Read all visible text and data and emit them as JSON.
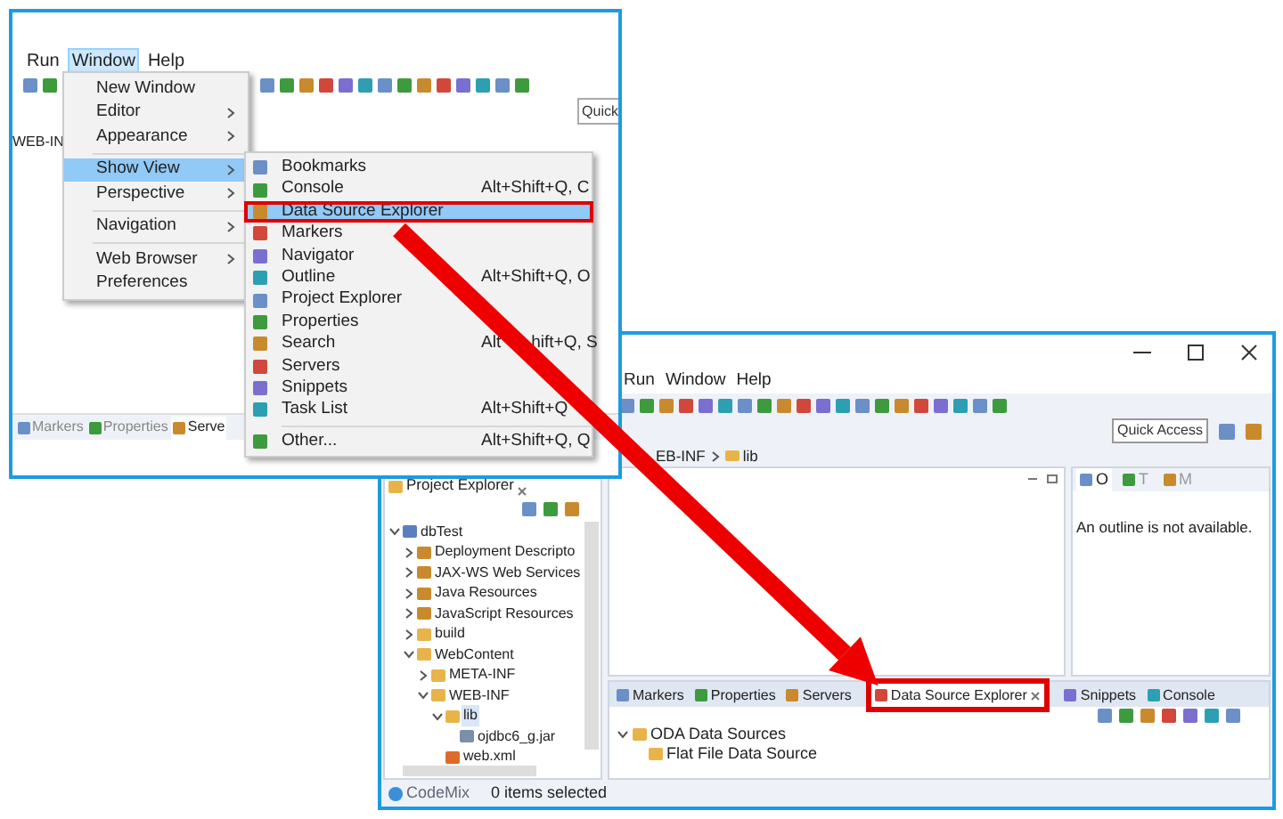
{
  "left_window": {
    "menu_bar": [
      {
        "label": "Run",
        "selected": false
      },
      {
        "label": "Window",
        "selected": true
      },
      {
        "label": "Help",
        "selected": false
      }
    ],
    "quick_access": {
      "placeholder": "Quick"
    },
    "breadcrumb": "WEB-IN",
    "bottom_tabs": [
      {
        "label": "Markers",
        "selected": false
      },
      {
        "label": "Properties",
        "selected": false
      },
      {
        "label": "Serve",
        "selected": true
      }
    ],
    "window_menu": [
      {
        "kind": "item",
        "label": "New Window",
        "submenu": false,
        "selected": false
      },
      {
        "kind": "item",
        "label": "Editor",
        "submenu": true,
        "selected": false
      },
      {
        "kind": "item",
        "label": "Appearance",
        "submenu": true,
        "selected": false
      },
      {
        "kind": "separator"
      },
      {
        "kind": "item",
        "label": "Show View",
        "submenu": true,
        "selected": true
      },
      {
        "kind": "item",
        "label": "Perspective",
        "submenu": true,
        "selected": false
      },
      {
        "kind": "separator"
      },
      {
        "kind": "item",
        "label": "Navigation",
        "submenu": true,
        "selected": false
      },
      {
        "kind": "separator"
      },
      {
        "kind": "item",
        "label": "Web Browser",
        "submenu": true,
        "selected": false
      },
      {
        "kind": "item",
        "label": "Preferences",
        "submenu": false,
        "selected": false
      }
    ],
    "show_view_menu": [
      {
        "kind": "item",
        "label": "Bookmarks",
        "selected": false
      },
      {
        "kind": "item",
        "label": "Console",
        "shortcut": "Alt+Shift+Q, C",
        "selected": false
      },
      {
        "kind": "item",
        "label": "Data Source Explorer",
        "selected": true
      },
      {
        "kind": "item",
        "label": "Markers",
        "selected": false
      },
      {
        "kind": "item",
        "label": "Navigator",
        "selected": false
      },
      {
        "kind": "item",
        "label": "Outline",
        "shortcut": "Alt+Shift+Q, O",
        "selected": false
      },
      {
        "kind": "item",
        "label": "Project Explorer",
        "selected": false
      },
      {
        "kind": "item",
        "label": "Properties",
        "selected": false
      },
      {
        "kind": "item",
        "label": "Search",
        "shortcut": [
          "Alt",
          "hift+Q, S"
        ],
        "selected": false
      },
      {
        "kind": "item",
        "label": "Servers",
        "selected": false
      },
      {
        "kind": "item",
        "label": "Snippets",
        "selected": false
      },
      {
        "kind": "item",
        "label": "Task List",
        "shortcut": "Alt+Shift+Q",
        "selected": false
      },
      {
        "kind": "separator"
      },
      {
        "kind": "item",
        "label": "Other...",
        "shortcut": "Alt+Shift+Q, Q",
        "selected": false
      }
    ]
  },
  "right_window": {
    "menu_bar": [
      "Run",
      "Window",
      "Help"
    ],
    "quick_access": {
      "placeholder": "Quick Access"
    },
    "breadcrumb": [
      "EB-INF",
      "lib"
    ],
    "project_explorer": {
      "title": "Project Explorer",
      "tree": [
        {
          "kind": "project",
          "label": "dbTest",
          "expanded": true,
          "selected": false,
          "children": [
            {
              "kind": "node",
              "label": "Deployment Descripto",
              "expanded": false,
              "selected": false
            },
            {
              "kind": "node",
              "label": "JAX-WS Web Services",
              "expanded": false,
              "selected": false
            },
            {
              "kind": "node",
              "label": "Java Resources",
              "expanded": false,
              "selected": false
            },
            {
              "kind": "node",
              "label": "JavaScript Resources",
              "expanded": false,
              "selected": false
            },
            {
              "kind": "folder",
              "label": "build",
              "expanded": false,
              "selected": false
            },
            {
              "kind": "folder",
              "label": "WebContent",
              "expanded": true,
              "selected": false,
              "children": [
                {
                  "kind": "folder",
                  "label": "META-INF",
                  "expanded": false,
                  "selected": false
                },
                {
                  "kind": "folder",
                  "label": "WEB-INF",
                  "expanded": true,
                  "selected": false,
                  "children": [
                    {
                      "kind": "folder",
                      "label": "lib",
                      "expanded": true,
                      "selected": true,
                      "children": [
                        {
                          "kind": "file",
                          "label": "ojdbc6_g.jar",
                          "selected": false
                        }
                      ]
                    },
                    {
                      "kind": "xml",
                      "label": "web.xml",
                      "selected": false
                    }
                  ]
                }
              ]
            }
          ]
        }
      ]
    },
    "outline": {
      "tabs": [
        {
          "label": "O",
          "selected": true
        },
        {
          "label": "T",
          "selected": false
        },
        {
          "label": "M",
          "selected": false
        }
      ],
      "message": "An outline is not available."
    },
    "bottom_tabs": [
      {
        "label": "Markers",
        "selected": false
      },
      {
        "label": "Properties",
        "selected": false
      },
      {
        "label": "Servers",
        "selected": false
      },
      {
        "label": "Data Source Explorer",
        "selected": true
      },
      {
        "label": "Snippets",
        "selected": false
      },
      {
        "label": "Console",
        "selected": false
      }
    ],
    "data_sources": [
      {
        "label": "ODA Data Sources",
        "expanded": true,
        "children": [
          {
            "label": "Flat File Data Source"
          }
        ]
      }
    ],
    "status_bar": {
      "app": "CodeMix",
      "message": "0 items selected"
    }
  }
}
